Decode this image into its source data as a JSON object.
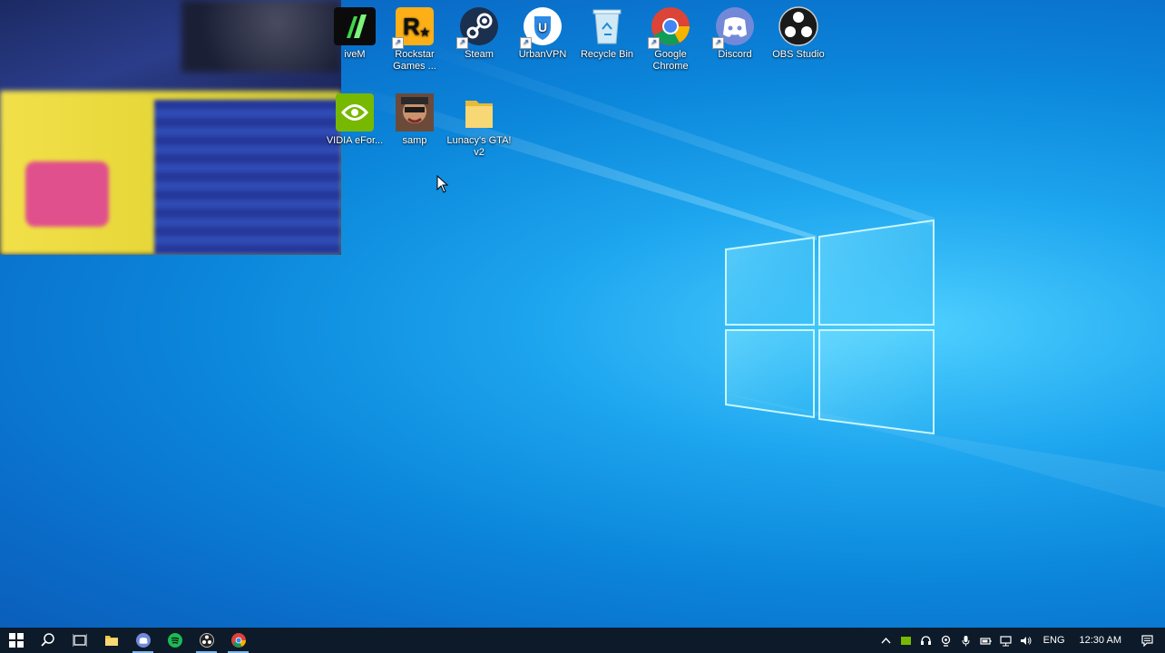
{
  "desktop": {
    "icons_row1": [
      {
        "label": "FiveM",
        "name": "fivem-icon"
      },
      {
        "label": "Rockstar Games ...",
        "name": "rockstar-games-icon"
      },
      {
        "label": "Steam",
        "name": "steam-icon"
      },
      {
        "label": "UrbanVPN",
        "name": "urbanvpn-icon"
      },
      {
        "label": "Recycle Bin",
        "name": "recycle-bin-icon"
      },
      {
        "label": "Google Chrome",
        "name": "google-chrome-icon"
      },
      {
        "label": "Discord",
        "name": "discord-icon"
      },
      {
        "label": "OBS Studio",
        "name": "obs-studio-icon"
      }
    ],
    "icons_row2": [
      {
        "label": "NVIDIA GeFor...",
        "name": "nvidia-geforce-icon"
      },
      {
        "label": "samp",
        "name": "samp-icon"
      },
      {
        "label": "Lunacy's GTA! v2",
        "name": "folder-icon"
      }
    ],
    "visible_labels": {
      "fivem": "iveM",
      "rockstar": "Rockstar Games ...",
      "steam": "Steam",
      "urbanvpn": "UrbanVPN",
      "recycle": "Recycle Bin",
      "chrome": "Google Chrome",
      "discord": "Discord",
      "obs": "OBS Studio",
      "nvidia": "VIDIA eFor...",
      "samp": "samp",
      "lunacy": "Lunacy's GTA! v2"
    }
  },
  "taskbar": {
    "pinned": [
      "start-icon",
      "search-icon",
      "task-view-icon",
      "file-explorer-icon",
      "discord-icon",
      "spotify-icon",
      "obs-studio-icon",
      "google-chrome-icon"
    ],
    "language": "ENG",
    "time": "12:30 AM"
  },
  "colors": {
    "taskbar": "#0d1a2a",
    "accent": "#7fb6e8",
    "wallpaper": "#1ea6ef"
  }
}
